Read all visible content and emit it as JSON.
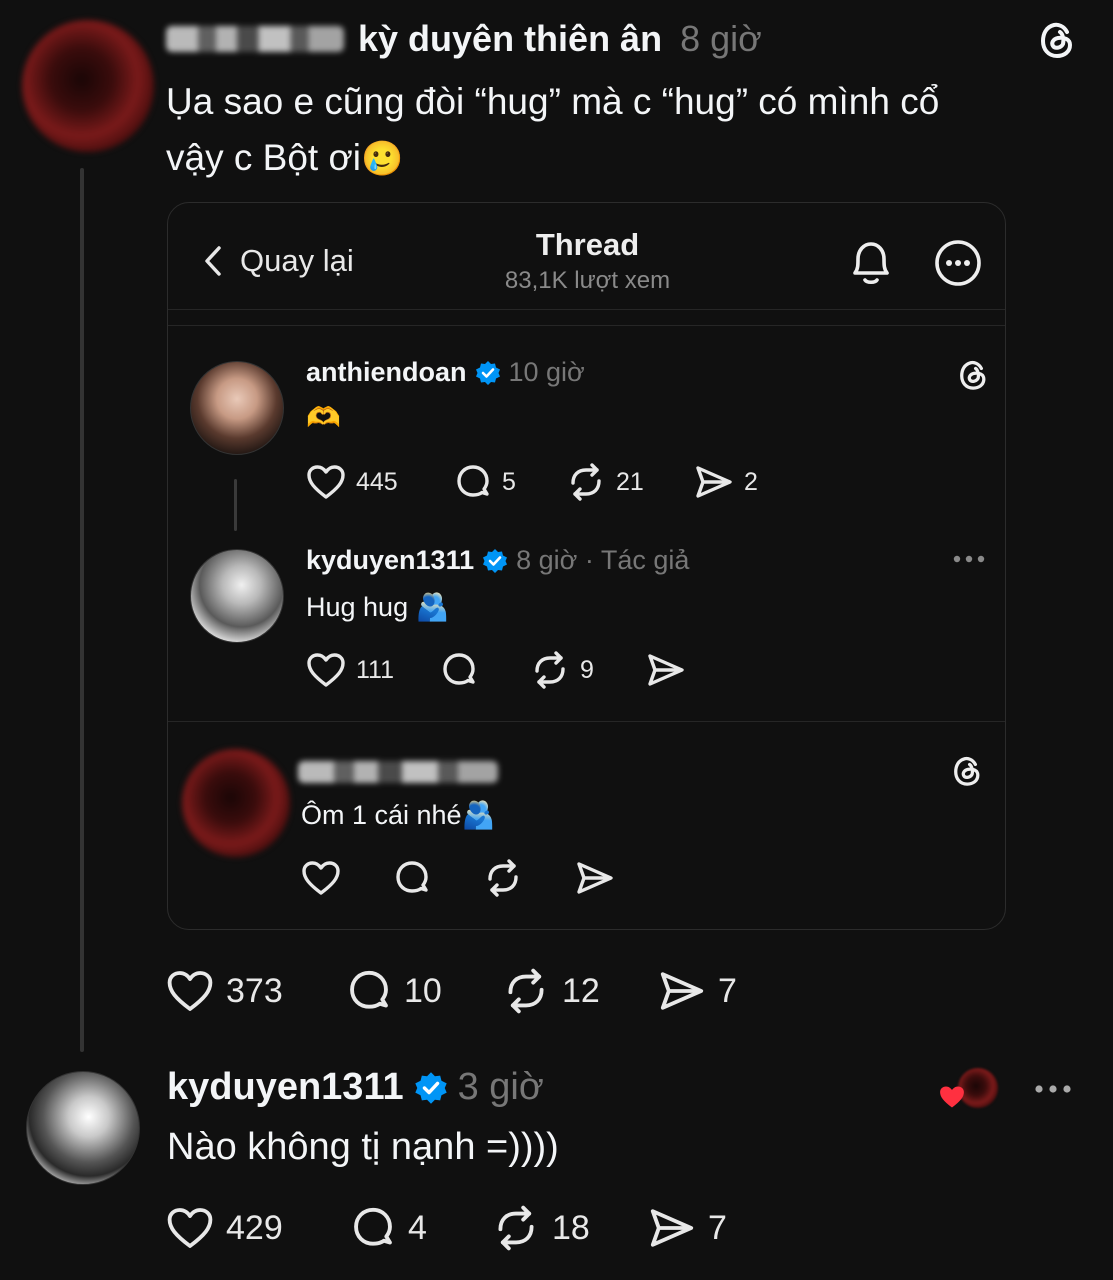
{
  "post": {
    "author_display": "kỳ duyên thiên ân",
    "time": "8 giờ",
    "text_line1": "Ụa sao e cũng đòi “hug” mà c “hug” có mình cổ",
    "text_line2": "vậy c Bột ơi",
    "emoji": "🥲",
    "stats": {
      "likes": "373",
      "replies": "10",
      "reposts": "12",
      "shares": "7"
    }
  },
  "embed": {
    "back_label": "Quay lại",
    "title": "Thread",
    "views": "83,1K lượt xem",
    "posts": [
      {
        "username": "anthiendoan",
        "time": "10 giờ",
        "text": "🫶",
        "likes": "445",
        "replies": "5",
        "reposts": "21",
        "shares": "2"
      },
      {
        "username": "kyduyen1311",
        "time": "8 giờ · Tác giả",
        "text": "Hug hug 🫂",
        "likes": "111",
        "reposts": "9"
      },
      {
        "text": "Ôm 1 cái nhé🫂"
      }
    ]
  },
  "reply": {
    "username": "kyduyen1311",
    "time": "3 giờ",
    "text": "Nào không tị nạnh =))))",
    "stats": {
      "likes": "429",
      "replies": "4",
      "reposts": "18",
      "shares": "7"
    }
  },
  "colors": {
    "background": "#101010",
    "verified": "#0095f6",
    "heart": "#ff3040"
  }
}
